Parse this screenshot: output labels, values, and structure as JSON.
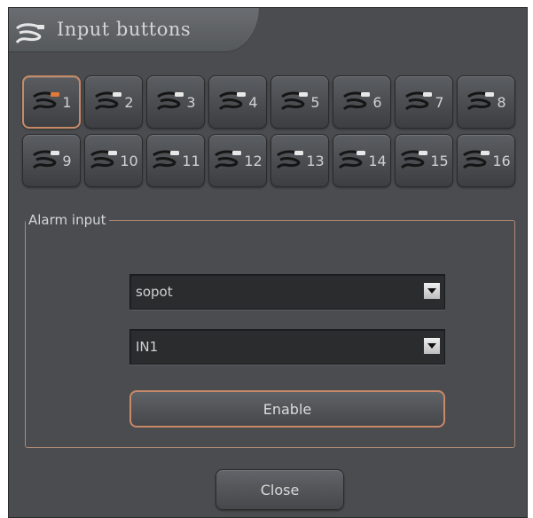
{
  "dialog": {
    "title": "Input buttons",
    "title_icon": "cable-plug-icon"
  },
  "channels": {
    "icon": "cable-plug-icon",
    "active_index": 0,
    "active_plug_color": "#e07a3a",
    "inactive_plug_color": "#e8e8e8",
    "items": [
      {
        "label": "1"
      },
      {
        "label": "2"
      },
      {
        "label": "3"
      },
      {
        "label": "4"
      },
      {
        "label": "5"
      },
      {
        "label": "6"
      },
      {
        "label": "7"
      },
      {
        "label": "8"
      },
      {
        "label": "9"
      },
      {
        "label": "10"
      },
      {
        "label": "11"
      },
      {
        "label": "12"
      },
      {
        "label": "13"
      },
      {
        "label": "14"
      },
      {
        "label": "15"
      },
      {
        "label": "16"
      }
    ]
  },
  "alarm": {
    "legend": "Alarm input",
    "device_select": {
      "value": "sopot"
    },
    "input_select": {
      "value": "IN1"
    },
    "enable_label": "Enable"
  },
  "footer": {
    "close_label": "Close"
  },
  "colors": {
    "window_bg": "#4a4c4f",
    "accent_border": "#c8896a"
  }
}
